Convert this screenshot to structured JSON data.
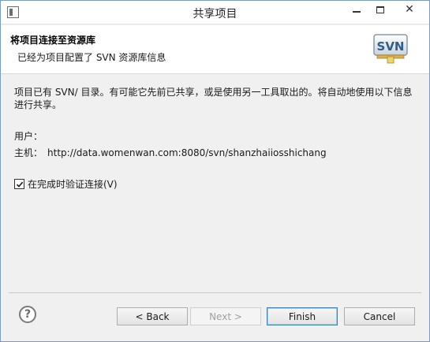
{
  "window": {
    "title": "共享项目"
  },
  "title_buttons": {
    "minimize_icon": "minimize-icon",
    "maximize_icon": "maximize-icon",
    "close_glyph": "✕"
  },
  "header": {
    "title": "将项目连接至资源库",
    "subtitle": "已经为项目配置了 SVN 资源库信息",
    "logo_text": "SVN"
  },
  "body": {
    "message": "项目已有 SVN/ 目录。有可能它先前已共享，或是使用另一工具取出的。将自动地使用以下信息进行共享。",
    "user_label": "用户：",
    "user_value": "",
    "host_label": "主机：",
    "host_value": "http://data.womenwan.com:8080/svn/shanzhaiiosshichang",
    "validate_checkbox": {
      "label": "在完成时验证连接(V)",
      "checked": true
    }
  },
  "footer": {
    "help_glyph": "?",
    "back_label": "< Back",
    "next_label": "Next >",
    "finish_label": "Finish",
    "cancel_label": "Cancel"
  },
  "colors": {
    "window_bg": "#f0f0f0",
    "header_bg": "#ffffff",
    "border": "#7a9cc4",
    "default_button_border": "#3c7fb1",
    "disabled_text": "#a0a0a0"
  }
}
